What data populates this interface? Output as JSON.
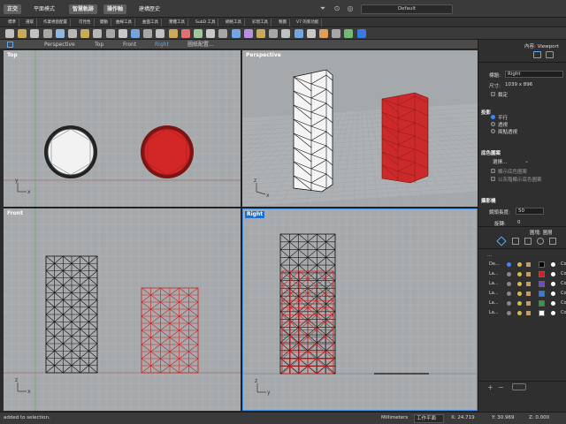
{
  "topbar": {
    "tabs": [
      "正交",
      "平面模式",
      "智慧軌跡",
      "操作軸",
      "建構歷史"
    ],
    "layout": "Default"
  },
  "command_tabs": [
    "標準",
    "選取",
    "作業視窗配置",
    "可見性",
    "變動",
    "曲線工具",
    "曲面工具",
    "實體工具",
    "SubD 工具",
    "網格工具",
    "彩現工具",
    "製圖",
    "V7 的新功能"
  ],
  "viewport_tabs": [
    "Perspective",
    "Top",
    "Front",
    "Right",
    "圖紙配置..."
  ],
  "active_viewport_tab": "Right",
  "viewports": {
    "top": {
      "title": "Top"
    },
    "perspective": {
      "title": "Perspective"
    },
    "front": {
      "title": "Front"
    },
    "right": {
      "title": "Right"
    }
  },
  "axis": {
    "x": "x",
    "y": "y",
    "z": "z"
  },
  "panel": {
    "header": "內容: Viewport",
    "title_label": "標題:",
    "title_value": "Right",
    "size_label": "尺寸:",
    "size_value": "1039 x 896",
    "lock_label": "鎖定",
    "projection_head": "投影",
    "projection_options": [
      "平行",
      "透視",
      "兩點透視"
    ],
    "projection_selected": 0,
    "background_head": "底色圖案",
    "background_select": "選擇...",
    "background_opts": [
      "顯示底色圖案",
      "以灰階顯示底色圖案"
    ],
    "camera_head": "攝影機",
    "lens_label": "鏡頭長度:",
    "lens_value": "50",
    "rotation_label": "旋轉:",
    "rotation_value": "0",
    "layers_head": "圖塊: 圖層",
    "layers_col": "...",
    "layers": [
      {
        "name": "De...",
        "color": "#000000",
        "current": true
      },
      {
        "name": "La...",
        "color": "#cc2222",
        "current": false
      },
      {
        "name": "La...",
        "color": "#6b4bd6",
        "current": false
      },
      {
        "name": "La...",
        "color": "#3a7bd5",
        "current": false
      },
      {
        "name": "La...",
        "color": "#2ea043",
        "current": false
      },
      {
        "name": "La...",
        "color": "#ffffff",
        "current": false
      }
    ],
    "layer_suffix": "Co"
  },
  "status": {
    "message": "added to selection.",
    "units": "Millimeters",
    "cplane": "工作平面",
    "x": "X: 24.719",
    "y": "Y: 30.969",
    "z": "Z: 0.000"
  }
}
